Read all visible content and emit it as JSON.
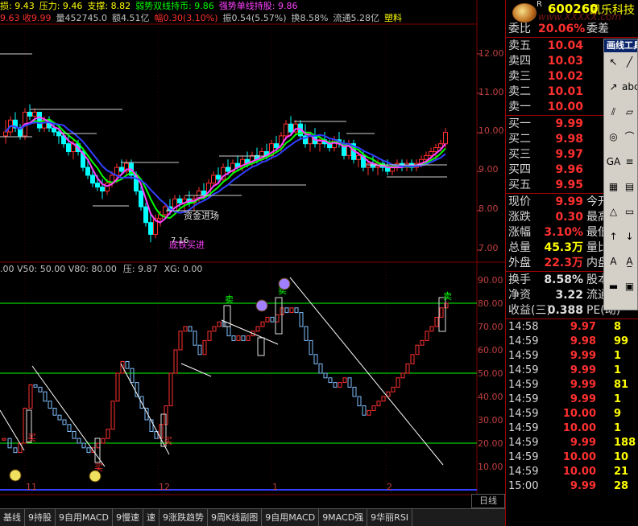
{
  "info_bar": {
    "line1": [
      {
        "text": "损: 9.43",
        "color": "#ffff00"
      },
      {
        "text": "压力: 9.46",
        "color": "#ffff00"
      },
      {
        "text": "支撑: 8.82",
        "color": "#ffff00"
      },
      {
        "text": "弱势双线持币: 9.86",
        "color": "#00ff00"
      },
      {
        "text": "强势单线持股: 9.86",
        "color": "#ff40ff"
      }
    ],
    "line2": [
      {
        "text": "9.63 收9.99",
        "color": "#ff3030"
      },
      {
        "text": "量452745.0",
        "color": "#c0c0c0"
      },
      {
        "text": "额4.51亿",
        "color": "#c0c0c0"
      },
      {
        "text": "幅0.30(3.10%)",
        "color": "#ff3030"
      },
      {
        "text": "振0.54(5.57%)",
        "color": "#c0c0c0"
      },
      {
        "text": "换8.58%",
        "color": "#c0c0c0"
      },
      {
        "text": "流通5.28亿",
        "color": "#c0c0c0"
      },
      {
        "text": "塑料",
        "color": "#ffff00"
      }
    ]
  },
  "price_axis": [
    "12.00",
    "11.00",
    "10.00",
    "9.00",
    "8.00",
    "7.00"
  ],
  "annotations": {
    "fund_enter": "资金进场",
    "bottom_label": "底铁买进",
    "low_value": "7.16"
  },
  "oscillator": {
    "header": [
      {
        "text": ".00 V50: 50.00 V80: 80.00",
        "color": "#c0c0c0"
      },
      {
        "text": "压: 9.87",
        "color": "#c0c0c0"
      },
      {
        "text": "XG: 0.00",
        "color": "#c0c0c0"
      }
    ],
    "axis": [
      "90.00",
      "80.00",
      "70.00",
      "60.00",
      "50.00",
      "40.00",
      "30.00",
      "20.00",
      "10.00"
    ],
    "sell_label": "卖",
    "buy_label": "买"
  },
  "date_axis": [
    "11",
    "12",
    "1",
    "2"
  ],
  "period_label": "日线",
  "tabs": [
    "基线",
    "9持股",
    "9自用MACD",
    "9慢速",
    "速",
    "9涨跌趋势",
    "9周K线副图",
    "9自用MACD",
    "9MACD强",
    "9华丽RSI"
  ],
  "quote": {
    "logo_r": "R",
    "code": "600260",
    "name": "凯乐科技",
    "watermark": "www.XXXXX.com",
    "commission": {
      "label": "委比",
      "value": "20.06%",
      "extra": "委差"
    },
    "asks": [
      {
        "label": "卖五",
        "price": "10.04"
      },
      {
        "label": "卖四",
        "price": "10.03"
      },
      {
        "label": "卖三",
        "price": "10.02"
      },
      {
        "label": "卖二",
        "price": "10.01"
      },
      {
        "label": "卖一",
        "price": "10.00"
      }
    ],
    "bids": [
      {
        "label": "买一",
        "price": "9.99"
      },
      {
        "label": "买二",
        "price": "9.98"
      },
      {
        "label": "买三",
        "price": "9.97"
      },
      {
        "label": "买四",
        "price": "9.96"
      },
      {
        "label": "买五",
        "price": "9.95"
      }
    ],
    "stats": [
      {
        "label": "现价",
        "value": "9.99",
        "extra": "今开",
        "color": "#ff3030"
      },
      {
        "label": "涨跌",
        "value": "0.30",
        "extra": "最高",
        "color": "#ff3030"
      },
      {
        "label": "涨幅",
        "value": "3.10%",
        "extra": "最低",
        "color": "#ff3030"
      },
      {
        "label": "总量",
        "value": "45.3万",
        "extra": "量比",
        "color": "#ffff00"
      },
      {
        "label": "外盘",
        "value": "22.3万",
        "extra": "内盘",
        "color": "#ff3030"
      }
    ],
    "stats2": [
      {
        "label": "换手",
        "value": "8.58%",
        "extra": "股本",
        "color": "#e0e0e0"
      },
      {
        "label": "净资",
        "value": "3.22",
        "extra": "流通",
        "color": "#e0e0e0"
      },
      {
        "label": "收益(三)",
        "value": "0.388",
        "extra": "PE(动)",
        "color": "#e0e0e0"
      }
    ]
  },
  "ticks": [
    {
      "time": "14:58",
      "price": "9.97",
      "vol": "8"
    },
    {
      "time": "14:59",
      "price": "9.98",
      "vol": "99"
    },
    {
      "time": "14:59",
      "price": "9.99",
      "vol": "1"
    },
    {
      "time": "14:59",
      "price": "9.99",
      "vol": "1"
    },
    {
      "time": "14:59",
      "price": "9.99",
      "vol": "81"
    },
    {
      "time": "14:59",
      "price": "9.99",
      "vol": "1"
    },
    {
      "time": "14:59",
      "price": "10.00",
      "vol": "9"
    },
    {
      "time": "14:59",
      "price": "10.00",
      "vol": "1"
    },
    {
      "time": "14:59",
      "price": "9.99",
      "vol": "188"
    },
    {
      "time": "14:59",
      "price": "10.00",
      "vol": "10"
    },
    {
      "time": "14:59",
      "price": "10.00",
      "vol": "21"
    },
    {
      "time": "15:00",
      "price": "9.99",
      "vol": "28"
    }
  ],
  "draw_toolbox": {
    "title": "画线工具",
    "tools": [
      "arrow-icon",
      "line-icon",
      "ray-icon",
      "text-abc-icon",
      "parallel-icon",
      "channel-icon",
      "circle-icon",
      "arc-icon",
      "ga-icon",
      "fib-icon",
      "gann-icon",
      "grid-icon",
      "triangle-icon",
      "rect-icon",
      "up-arrow-icon",
      "down-arrow-icon",
      "text-a-icon",
      "text-a2-icon",
      "rect-tool-icon",
      "label-icon"
    ]
  },
  "colors": {
    "up": "#ff3030",
    "down": "#00ffff",
    "ma1": "#ff40ff",
    "ma2": "#00ff00",
    "ma3": "#3040ff",
    "panel_border": "#a00000"
  }
}
